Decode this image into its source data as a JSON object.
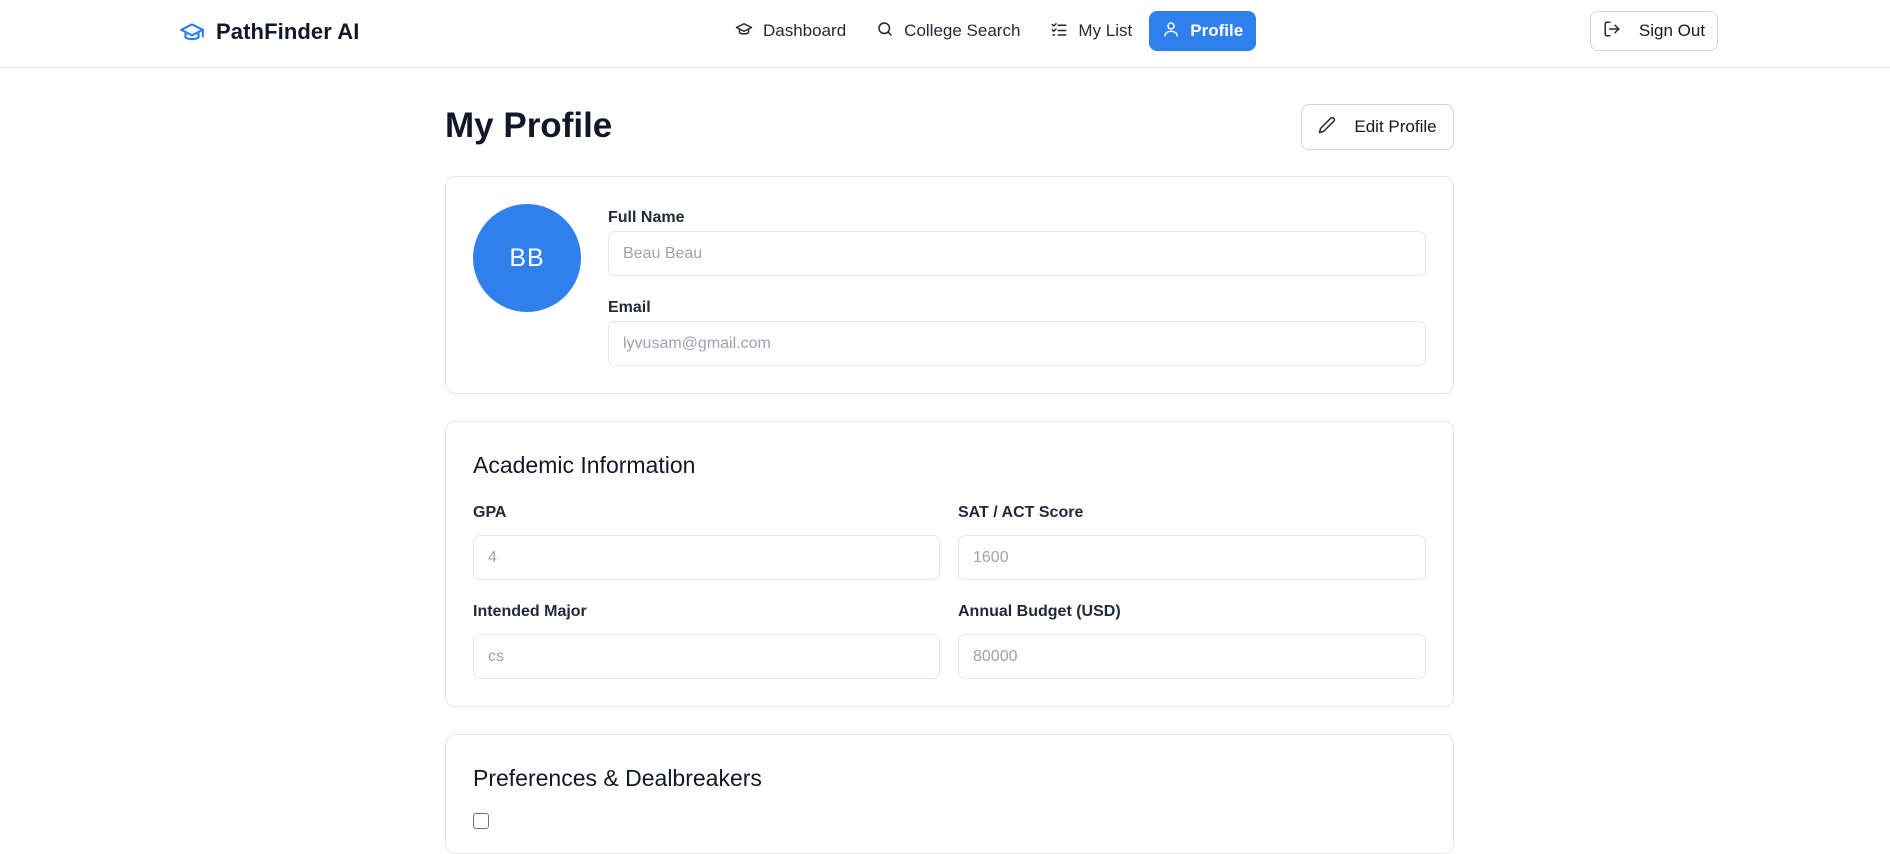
{
  "app": {
    "brand_name": "PathFinder AI",
    "brand_icon": "graduation-cap-icon",
    "accent_color": "#2f80ed"
  },
  "nav": {
    "items": [
      {
        "label": "Dashboard",
        "icon": "graduation-cap-icon",
        "active": false
      },
      {
        "label": "College Search",
        "icon": "search-icon",
        "active": false
      },
      {
        "label": "My List",
        "icon": "checklist-icon",
        "active": false
      },
      {
        "label": "Profile",
        "icon": "user-icon",
        "active": true
      }
    ],
    "sign_out_label": "Sign Out",
    "sign_out_icon": "log-out-icon"
  },
  "page": {
    "title": "My Profile",
    "edit_button_label": "Edit Profile",
    "edit_icon": "pencil-icon"
  },
  "profile": {
    "avatar_initials": "BB",
    "full_name_label": "Full Name",
    "full_name_value": "Beau Beau",
    "email_label": "Email",
    "email_value": "lyvusam@gmail.com"
  },
  "academic": {
    "title": "Academic Information",
    "gpa_label": "GPA",
    "gpa_value": "4",
    "score_label": "SAT / ACT Score",
    "score_value": "1600",
    "major_label": "Intended Major",
    "major_value": "cs",
    "budget_label": "Annual Budget (USD)",
    "budget_value": "80000"
  },
  "preferences": {
    "title": "Preferences & Dealbreakers"
  }
}
